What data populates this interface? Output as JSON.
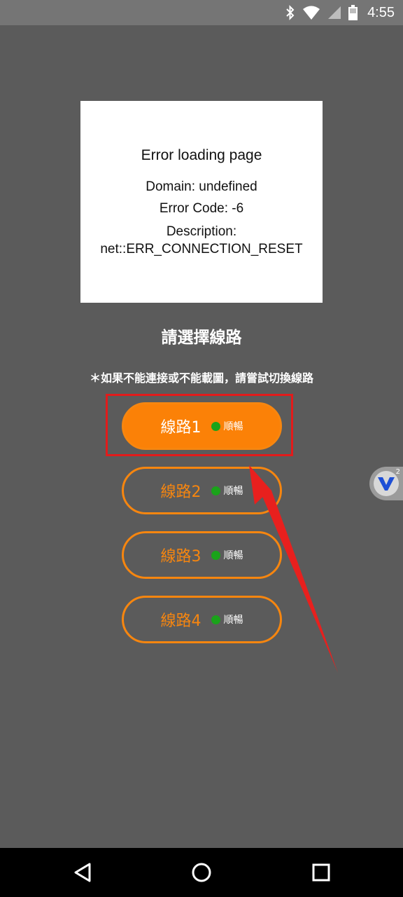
{
  "status_bar": {
    "time": "4:55",
    "icons": [
      "bluetooth-icon",
      "wifi-icon",
      "signal-icon",
      "battery-icon"
    ]
  },
  "error": {
    "title": "Error loading page",
    "domain": "Domain: undefined",
    "code": "Error Code: -6",
    "description_label": "Description:",
    "description_value": "net::ERR_CONNECTION_RESET"
  },
  "routes": {
    "title": "請選擇線路",
    "hint": "＊如果不能連接或不能載圖，請嘗試切換線路",
    "items": [
      {
        "label": "線路1",
        "status": "順暢"
      },
      {
        "label": "線路2",
        "status": "順暢"
      },
      {
        "label": "線路3",
        "status": "順暢"
      },
      {
        "label": "線路4",
        "status": "順暢"
      }
    ]
  },
  "float_button": {
    "icon": "v-logo-icon",
    "badge": "2"
  },
  "nav_bar": {
    "buttons": [
      "back-icon",
      "home-icon",
      "recents-icon"
    ]
  },
  "colors": {
    "background": "#5b5b5b",
    "accent": "#fb8107",
    "status_green": "#1aa31a",
    "highlight_red": "#e21b1b"
  }
}
